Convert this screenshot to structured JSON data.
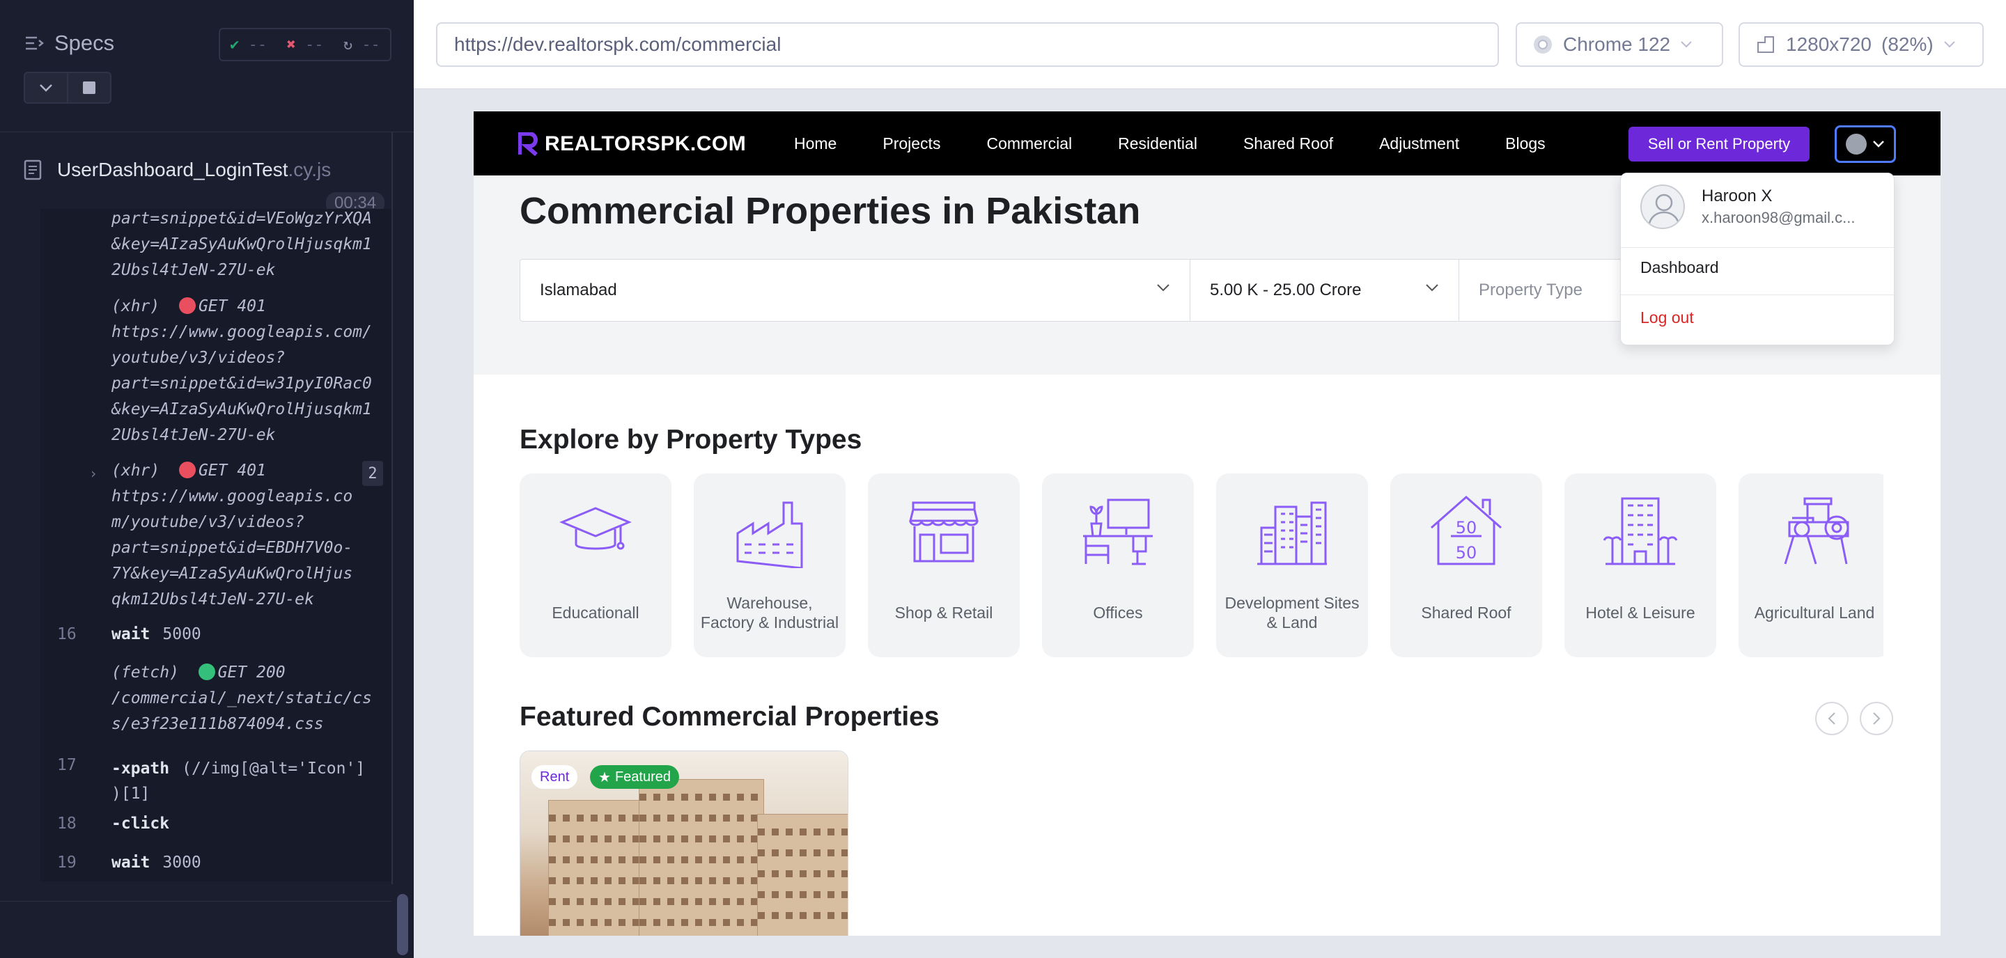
{
  "runner": {
    "specs_label": "Specs",
    "stats": {
      "passed": "--",
      "failed": "--",
      "pending": "--"
    },
    "spec_file": {
      "name": "UserDashboard_LoginTest",
      "ext": ".cy.js"
    },
    "timer": "00:34",
    "log": {
      "block1": "part=snippet&id=VEoWgzYrXQA\n&key=AIzaSyAuKwQrolHjusqkm1\n2Ubsl4tJeN-27U-ek",
      "block2_head": "(xhr)  ",
      "block2_method": "GET 401",
      "block2_body": "https://www.googleapis.com/\nyoutube/v3/videos?\npart=snippet&id=w31pyI0Rac0\n&key=AIzaSyAuKwQrolHjusqkm1\n2Ubsl4tJeN-27U-ek",
      "block3_head": "(xhr)  ",
      "block3_method": "GET 401",
      "block3_count": "2",
      "block3_body": "https://www.googleapis.co\nm/youtube/v3/videos?\npart=snippet&id=EBDH7V0o-\n7Y&key=AIzaSyAuKwQrolHjus\nqkm12Ubsl4tJeN-27U-ek",
      "block4_head": "(fetch)  ",
      "block4_method": "GET 200",
      "block4_body": "/commercial/_next/static/cs\ns/e3f23e111b874094.css",
      "lines": [
        {
          "num": "16",
          "cmd": "wait",
          "arg": "5000"
        },
        {
          "num": "17",
          "cmd": "-xpath",
          "arg": "(//img[@alt='Icon']",
          "arg2": ")[1]"
        },
        {
          "num": "18",
          "cmd": "-click",
          "arg": ""
        },
        {
          "num": "19",
          "cmd": "wait",
          "arg": "3000"
        }
      ]
    }
  },
  "browser": {
    "url": "https://dev.realtorspk.com/commercial",
    "browser_name": "Chrome 122",
    "viewport": "1280x720",
    "scale": "(82%)"
  },
  "site": {
    "logo_text": "REALTORSPK.COM",
    "nav": [
      "Home",
      "Projects",
      "Commercial",
      "Residential",
      "Shared Roof",
      "Adjustment",
      "Blogs"
    ],
    "sell_button": "Sell or Rent Property",
    "page_title": "Commercial Properties in Pakistan",
    "filter": {
      "city": "Islamabad",
      "price": "5.00 K - 25.00 Crore",
      "type_placeholder": "Property Type"
    },
    "explore_title": "Explore by Property Types",
    "property_types": [
      {
        "label": "Educationall",
        "icon": "graduation-cap-icon"
      },
      {
        "label": "Warehouse, Factory & Industrial",
        "icon": "factory-icon"
      },
      {
        "label": "Shop & Retail",
        "icon": "shop-icon"
      },
      {
        "label": "Offices",
        "icon": "office-desk-icon"
      },
      {
        "label": "Development Sites & Land",
        "icon": "buildings-icon"
      },
      {
        "label": "Shared Roof",
        "icon": "house-5050-icon"
      },
      {
        "label": "Hotel & Leisure",
        "icon": "hotel-icon"
      },
      {
        "label": "Agricultural Land",
        "icon": "tractor-icon"
      }
    ],
    "featured_title": "Featured Commercial Properties",
    "featured_card": {
      "tag_rent": "Rent",
      "tag_featured": "Featured"
    },
    "user_menu": {
      "name": "Haroon X",
      "email": "x.haroon98@gmail.c...",
      "dashboard": "Dashboard",
      "logout": "Log out"
    },
    "colors": {
      "brand": "#6d28d9",
      "logout": "#dc2626",
      "featured": "#22a54a"
    }
  }
}
